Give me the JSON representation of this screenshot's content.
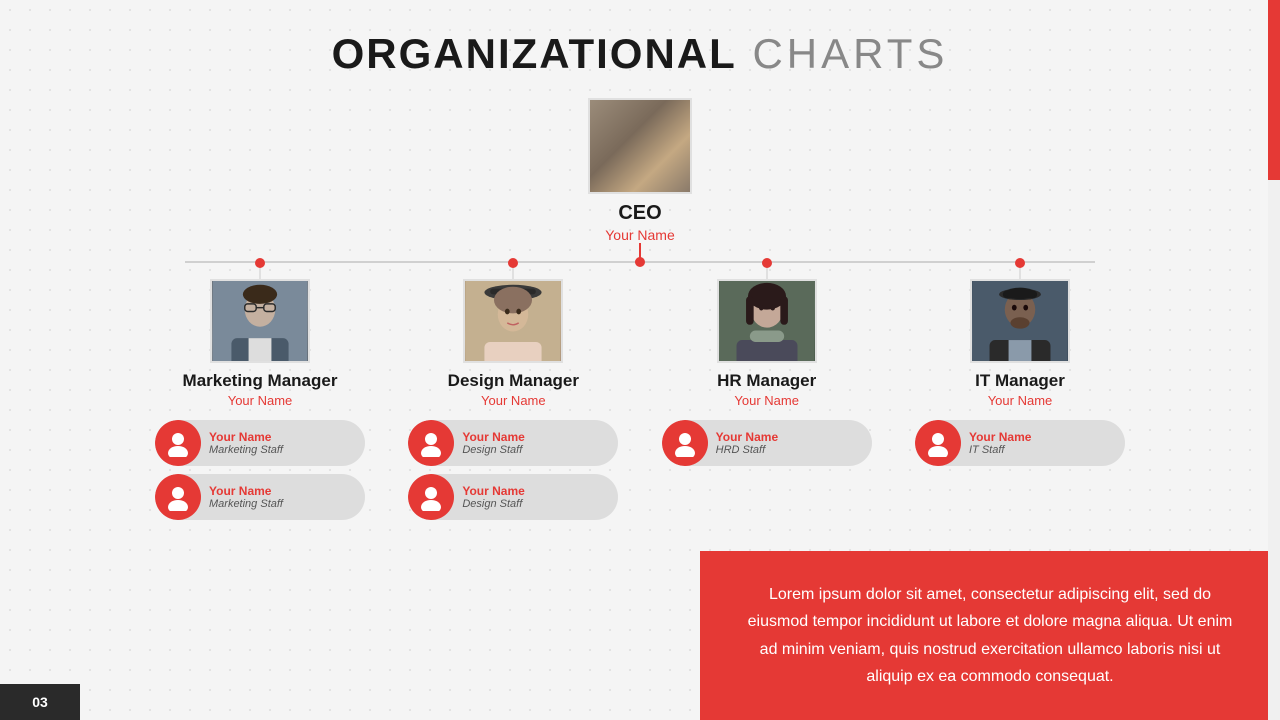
{
  "page": {
    "title_bold": "ORGANIZATIONAL",
    "title_light": " CHARTS",
    "slide_number": "03"
  },
  "ceo": {
    "title": "CEO",
    "name": "Your Name"
  },
  "managers": [
    {
      "id": "marketing",
      "title": "Marketing Manager",
      "name": "Your Name",
      "staff": [
        {
          "name": "Your Name",
          "role": "Marketing Staff"
        },
        {
          "name": "Your Name",
          "role": "Marketing Staff"
        }
      ]
    },
    {
      "id": "design",
      "title": "Design Manager",
      "name": "Your Name",
      "staff": [
        {
          "name": "Your Name",
          "role": "Design Staff"
        },
        {
          "name": "Your Name",
          "role": "Design Staff"
        }
      ]
    },
    {
      "id": "hr",
      "title": "HR Manager",
      "name": "Your Name",
      "staff": [
        {
          "name": "Your Name",
          "role": "HRD Staff"
        }
      ]
    },
    {
      "id": "it",
      "title": "IT Manager",
      "name": "Your Name",
      "staff": [
        {
          "name": "Your Name",
          "role": "IT Staff"
        }
      ]
    }
  ],
  "lorem": {
    "text": "Lorem ipsum dolor sit amet, consectetur adipiscing elit, sed do eiusmod tempor incididunt ut labore et dolore magna aliqua. Ut enim ad minim veniam, quis nostrud exercitation ullamco laboris nisi ut aliquip ex ea commodo consequat."
  },
  "colors": {
    "accent": "#e53935",
    "dark": "#1a1a1a",
    "gray": "#888888"
  }
}
